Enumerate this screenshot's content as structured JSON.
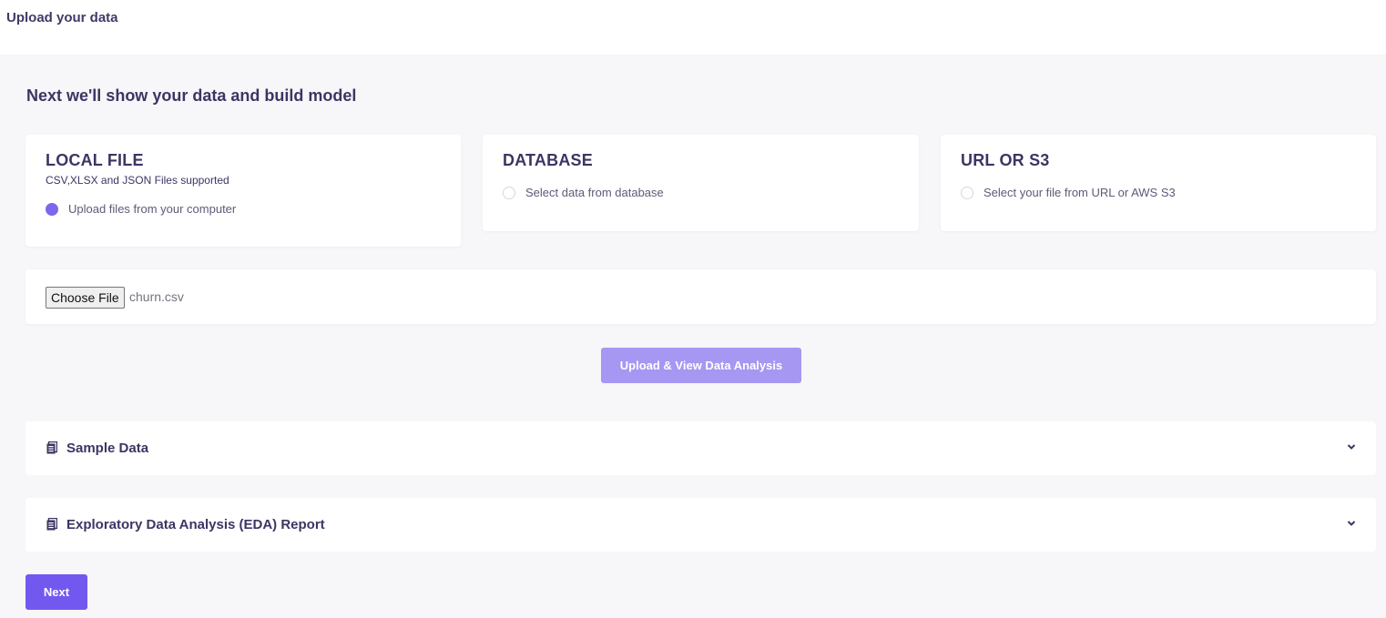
{
  "header": {
    "title": "Upload your data"
  },
  "section": {
    "title": "Next we'll show your data and build model"
  },
  "sources": [
    {
      "title": "LOCAL FILE",
      "subtitle": "CSV,XLSX and JSON Files supported",
      "option": "Upload files from your computer",
      "selected": true
    },
    {
      "title": "DATABASE",
      "option": "Select data from database",
      "selected": false
    },
    {
      "title": "URL OR S3",
      "option": "Select your file from URL or AWS S3",
      "selected": false
    }
  ],
  "file_input": {
    "button_label": "Choose File",
    "file_name": "churn.csv"
  },
  "upload_button": {
    "label": "Upload & View Data Analysis"
  },
  "accordions": [
    {
      "title": "Sample Data",
      "icon": "document-icon",
      "expanded": false
    },
    {
      "title": "Exploratory Data Analysis (EDA) Report",
      "icon": "document-icon",
      "expanded": false
    }
  ],
  "next_button": {
    "label": "Next"
  },
  "colors": {
    "accent": "#7358f0",
    "accent_disabled": "#a597f2",
    "radio_checked": "#7b68ee",
    "text_primary": "#3c3563",
    "background": "#f7f7f9"
  }
}
